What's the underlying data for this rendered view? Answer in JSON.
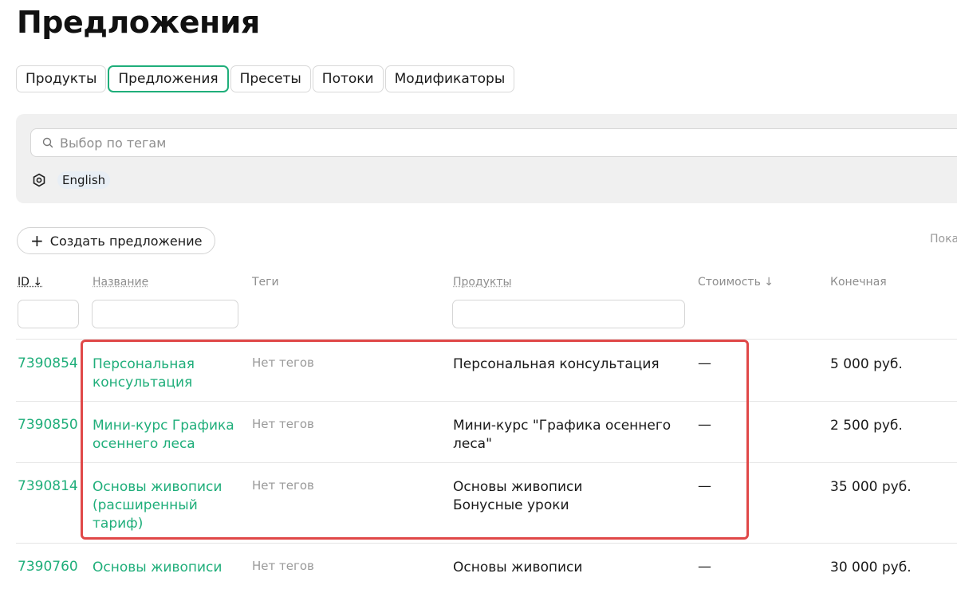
{
  "page": {
    "title": "Предложения"
  },
  "tabs": [
    {
      "label": "Продукты"
    },
    {
      "label": "Предложения"
    },
    {
      "label": "Пресеты"
    },
    {
      "label": "Потоки"
    },
    {
      "label": "Модификаторы"
    }
  ],
  "filters": {
    "search_placeholder": "Выбор по тегам",
    "language_tag": "English"
  },
  "toolbar": {
    "create_label": "Создать предложение",
    "show_partial": "Пока"
  },
  "table": {
    "headers": {
      "id": "ID ↓",
      "name": "Название",
      "tags": "Теги",
      "products": "Продукты",
      "cost": "Стоимость ↓",
      "final": "Конечная"
    },
    "rows": [
      {
        "id": "7390854",
        "name": "Персональная консультация",
        "tags": "Нет тегов",
        "products": "Персональная консультация",
        "cost": "—",
        "final": "5 000 руб."
      },
      {
        "id": "7390850",
        "name": "Мини-курс Графика осеннего леса",
        "tags": "Нет тегов",
        "products": "Мини-курс \"Графика осеннего леса\"",
        "cost": "—",
        "final": "2 500 руб."
      },
      {
        "id": "7390814",
        "name": "Основы живописи (расширенный тариф)",
        "tags": "Нет тегов",
        "products": "Основы живописи\nБонусные уроки",
        "cost": "—",
        "final": "35 000 руб."
      },
      {
        "id": "7390760",
        "name": "Основы живописи",
        "tags": "Нет тегов",
        "products": "Основы живописи",
        "cost": "—",
        "final": "30 000 руб."
      }
    ]
  },
  "colors": {
    "accent_green": "#1fae7a",
    "highlight_red": "#e04848"
  }
}
